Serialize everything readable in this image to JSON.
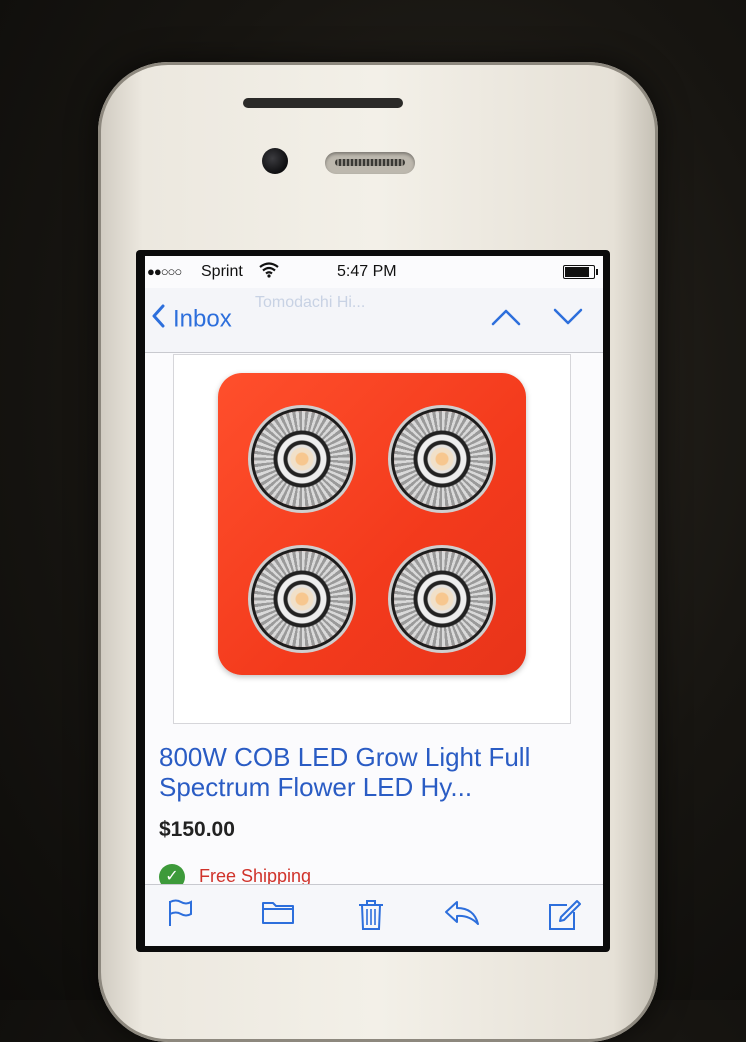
{
  "status_bar": {
    "signal": "●●○○○",
    "carrier": "Sprint",
    "time": "5:47 PM"
  },
  "nav": {
    "back_label": "Inbox",
    "ghost_text": "Tomodachi Hi..."
  },
  "product": {
    "title": "800W COB LED Grow Light Full Spectrum Flower LED Hy...",
    "price": "$150.00",
    "shipping": "Free Shipping"
  },
  "toolbar": {
    "icons": [
      "flag-icon",
      "folder-icon",
      "trash-icon",
      "reply-icon",
      "compose-icon"
    ]
  },
  "colors": {
    "accent": "#2d6fdc",
    "product_red": "#f33a1c",
    "shipping_red": "#d0332b",
    "check_green": "#3d9a3a"
  }
}
